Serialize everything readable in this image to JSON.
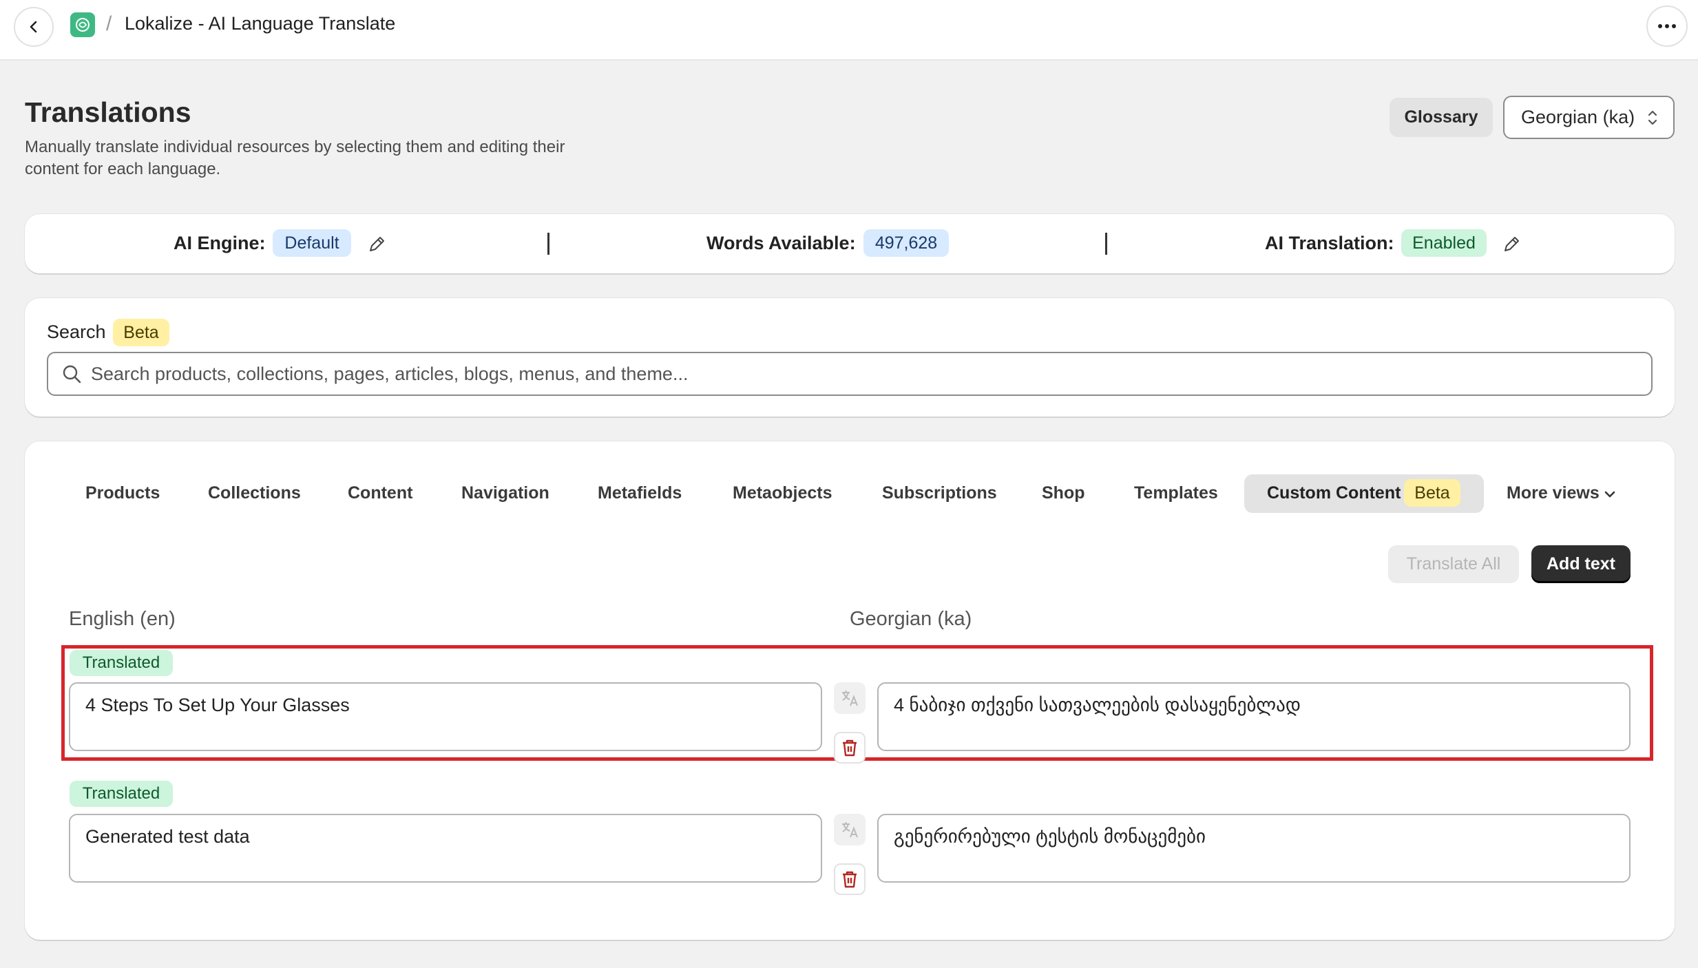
{
  "app": {
    "title": "Lokalize - AI Language Translate",
    "breadcrumb_separator": "/"
  },
  "header": {
    "title": "Translations",
    "subtitle": "Manually translate individual resources by selecting them and editing their content for each language.",
    "glossary_label": "Glossary",
    "language_select": "Georgian (ka)"
  },
  "stats": {
    "ai_engine_label": "AI Engine:",
    "ai_engine_value": "Default",
    "words_label": "Words Available:",
    "words_value": "497,628",
    "ai_translation_label": "AI Translation:",
    "ai_translation_value": "Enabled"
  },
  "search": {
    "label": "Search",
    "badge": "Beta",
    "placeholder": "Search products, collections, pages, articles, blogs, menus, and theme..."
  },
  "tabs": {
    "items": [
      {
        "label": "Products"
      },
      {
        "label": "Collections"
      },
      {
        "label": "Content"
      },
      {
        "label": "Navigation"
      },
      {
        "label": "Metafields"
      },
      {
        "label": "Metaobjects"
      },
      {
        "label": "Subscriptions"
      },
      {
        "label": "Shop"
      },
      {
        "label": "Templates"
      },
      {
        "label": "Custom Content",
        "badge": "Beta",
        "active": true
      },
      {
        "label": "More views"
      }
    ]
  },
  "actions": {
    "translate_all": "Translate All",
    "add_text": "Add text"
  },
  "columns": {
    "source": "English (en)",
    "target": "Georgian (ka)"
  },
  "rows": [
    {
      "status": "Translated",
      "source": "4 Steps To Set Up Your Glasses",
      "target": "4 ნაბიჯი თქვენი სათვალეების დასაყენებლად",
      "highlighted": true
    },
    {
      "status": "Translated",
      "source": "Generated test data",
      "target": "გენერირებული ტესტის მონაცემები",
      "highlighted": false
    }
  ],
  "colors": {
    "highlight_border": "#d7262a",
    "badge_green": "#cdf4dc",
    "badge_blue": "#d8eaff",
    "badge_yellow": "#fff0a3",
    "primary_button": "#2e2e2e"
  },
  "icons": [
    "chevron-left-icon",
    "app-logo-icon",
    "more-horizontal-icon",
    "select-chevrons-icon",
    "pencil-icon",
    "search-icon",
    "chevron-down-icon",
    "translate-icon",
    "trash-icon"
  ]
}
